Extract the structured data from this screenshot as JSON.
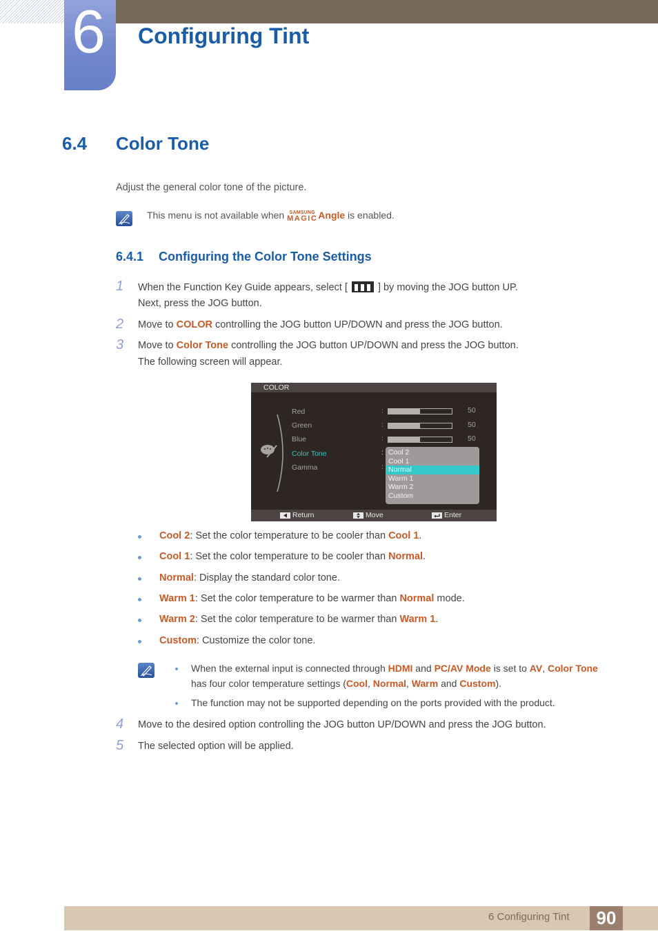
{
  "chapter": {
    "number": "6",
    "title": "Configuring Tint"
  },
  "section": {
    "number": "6.4",
    "title": "Color Tone"
  },
  "intro": "Adjust the general color tone of the picture.",
  "note1": {
    "before": "This menu is not available when ",
    "brand_top": "SAMSUNG",
    "brand_bottom": "MAGIC",
    "highlight": "Angle",
    "after": " is enabled."
  },
  "subsection": {
    "number": "6.4.1",
    "title": "Configuring the Color Tone Settings"
  },
  "steps": [
    {
      "num": "1",
      "line1_before": "When the Function Key Guide appears, select [",
      "line1_after": "] by moving the JOG button UP.",
      "line2": "Next, press the JOG button."
    },
    {
      "num": "2",
      "before": "Move to ",
      "highlight": "COLOR",
      "after": " controlling the JOG button UP/DOWN and press the JOG button."
    },
    {
      "num": "3",
      "before": "Move to ",
      "highlight": "Color Tone",
      "after": " controlling the JOG button UP/DOWN and press the JOG button.",
      "line2": "The following screen will appear."
    },
    {
      "num": "4",
      "text": "Move to the desired option controlling the JOG button UP/DOWN and press the JOG button."
    },
    {
      "num": "5",
      "text": "The selected option will be applied."
    }
  ],
  "osd": {
    "title": "COLOR",
    "items": [
      {
        "label": "Red",
        "value": "50",
        "level": 0.5
      },
      {
        "label": "Green",
        "value": "50",
        "level": 0.5
      },
      {
        "label": "Blue",
        "value": "50",
        "level": 0.5
      },
      {
        "label": "Color Tone"
      },
      {
        "label": "Gamma"
      }
    ],
    "separator": ":",
    "dropdown_options": [
      "Cool 2",
      "Cool 1",
      "Normal",
      "Warm 1",
      "Warm 2",
      "Custom"
    ],
    "selected_option": "Normal",
    "footer": {
      "return": "Return",
      "move": "Move",
      "enter": "Enter"
    },
    "accent_color": "#35c8c8"
  },
  "options": [
    {
      "name": "Cool 2",
      "mid": ": Set the color temperature to be cooler than ",
      "ref": "Cool 1",
      "end": "."
    },
    {
      "name": "Cool 1",
      "mid": ": Set the color temperature to be cooler than ",
      "ref": "Normal",
      "end": "."
    },
    {
      "name": "Normal",
      "mid": ": Display the standard color tone.",
      "ref": "",
      "end": ""
    },
    {
      "name": "Warm 1",
      "mid": ": Set the color temperature to be warmer than ",
      "ref": "Normal",
      "end": " mode."
    },
    {
      "name": "Warm 2",
      "mid": ": Set the color temperature to be warmer than ",
      "ref": "Warm 1",
      "end": "."
    },
    {
      "name": "Custom",
      "mid": ": Customize the color tone.",
      "ref": "",
      "end": ""
    }
  ],
  "note2": {
    "b1": {
      "t1": "When the external input is connected through ",
      "h1": "HDMI",
      "t2": " and ",
      "h2": "PC/AV Mode",
      "t3": " is set to ",
      "h3": "AV",
      "t4": ", ",
      "h4": "Color Tone",
      "t5": " has four color temperature settings (",
      "h5": "Cool",
      "t6": ", ",
      "h6": "Normal",
      "t7": ", ",
      "h7": "Warm",
      "t8": " and ",
      "h8": "Custom",
      "t9": ")."
    },
    "b2": "The function may not be supported depending on the ports provided with the product."
  },
  "footer": {
    "label": "6 Configuring Tint",
    "page": "90"
  },
  "colors": {
    "heading": "#1a5ca8",
    "highlight": "#c75a25",
    "step_number": "#8fa0d8",
    "top_bar": "#776958",
    "footer_bar": "#d8c8b3",
    "page_box": "#9a7f6f"
  }
}
